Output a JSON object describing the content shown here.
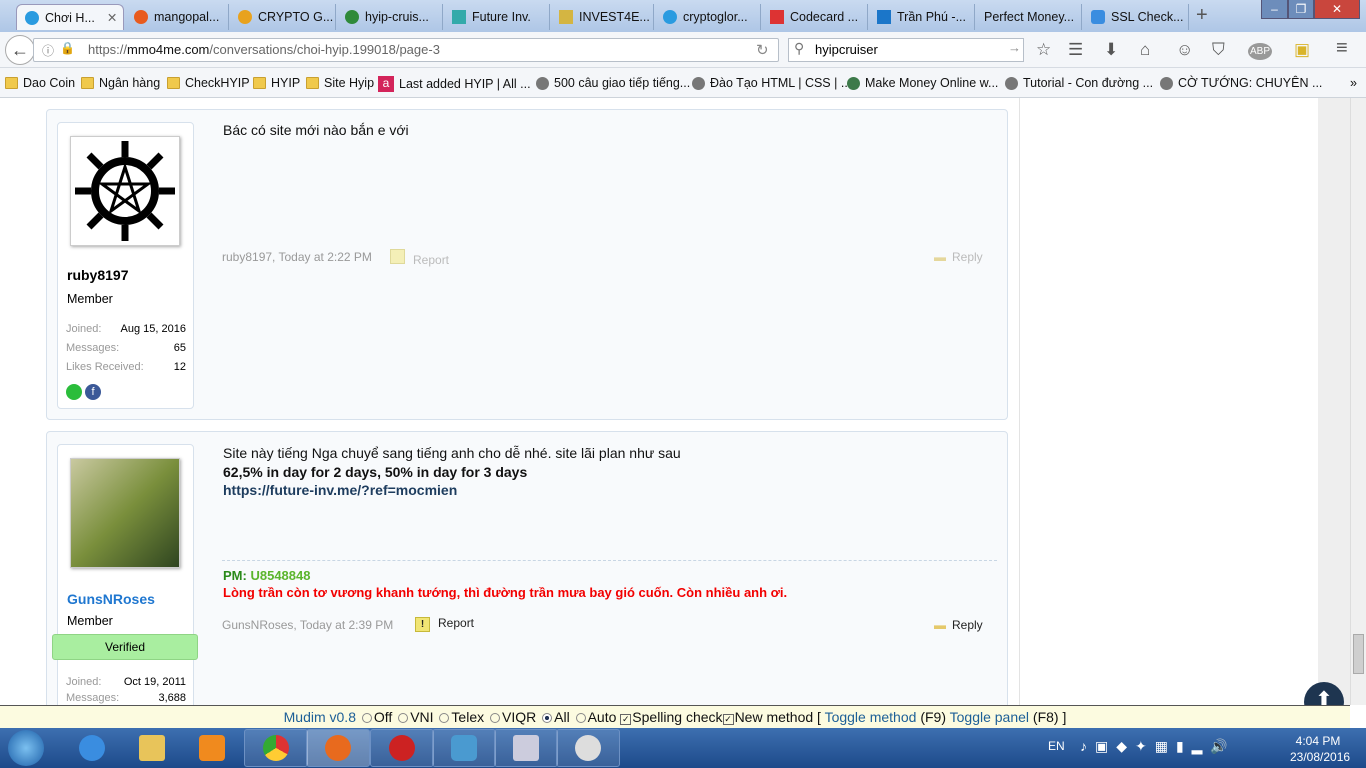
{
  "browser": {
    "tabs": [
      {
        "label": "Chơi H...",
        "active": true
      },
      {
        "label": "mangopal..."
      },
      {
        "label": "CRYPTO G..."
      },
      {
        "label": "hyip-cruis..."
      },
      {
        "label": "Future Inv."
      },
      {
        "label": "INVEST4E..."
      },
      {
        "label": "cryptoglor..."
      },
      {
        "label": "Codecard ..."
      },
      {
        "label": "Trần Phú -..."
      },
      {
        "label": "Perfect Money..."
      },
      {
        "label": "SSL Check..."
      }
    ],
    "new_tab": "+",
    "url_prefix": "https://",
    "url_domain": "mmo4me.com",
    "url_path": "/conversations/choi-hyip.199018/page-3",
    "search_value": "hyipcruiser",
    "bookmarks": [
      "Dao Coin",
      "Ngân hàng",
      "CheckHYIP",
      "HYIP",
      "Site Hyip",
      "Last added HYIP | All ...",
      "500 câu giao tiếp tiếng...",
      "Đào Tạo HTML | CSS | ...",
      "Make Money Online w...",
      "Tutorial - Con đường ...",
      "CỜ TƯỚNG: CHUYÊN ..."
    ],
    "bookmarks_overflow": "»"
  },
  "posts": [
    {
      "username": "ruby8197",
      "user_title": "Member",
      "joined_label": "Joined:",
      "joined": "Aug 15, 2016",
      "messages_label": "Messages:",
      "messages": "65",
      "likes_label": "Likes Received:",
      "likes": "12",
      "body": "Bác có site mới nào bắn e với",
      "meta": "ruby8197, Today at 2:22 PM",
      "report": "Report",
      "reply": "Reply"
    },
    {
      "username": "GunsNRoses",
      "user_title": "Member",
      "badge": "Verified",
      "joined_label": "Joined:",
      "joined": "Oct 19, 2011",
      "messages_label": "Messages:",
      "messages": "3,688",
      "body_line1": "Site này tiếng Nga chuyể sang tiếng anh cho dễ nhé. site lãi plan như sau",
      "body_line2": "62,5% in day for 2 days, 50% in day for 3 days",
      "body_link": "https://future-inv.me/?ref=mocmien",
      "sig_pm_label": "PM:",
      "sig_pm_value": "U8548848",
      "sig_text": "Lòng trần còn tơ vương khanh tướng, thì đường trần mưa bay gió cuốn. Còn nhiều anh ơi.",
      "meta": "GunsNRoses, Today at 2:39 PM",
      "report": "Report",
      "reply": "Reply"
    }
  ],
  "mudim": {
    "name": "Mudim v0.8",
    "options": [
      "Off",
      "VNI",
      "Telex",
      "VIQR",
      "All",
      "Auto"
    ],
    "selected": "All",
    "spelling": "Spelling check",
    "new_method": "New method",
    "open": "[",
    "toggle_method": "Toggle method",
    "f9": "(F9)",
    "toggle_panel": "Toggle panel",
    "f8": "(F8)",
    "close": "]"
  },
  "taskbar": {
    "lang": "EN",
    "time": "4:04 PM",
    "date": "23/08/2016"
  }
}
